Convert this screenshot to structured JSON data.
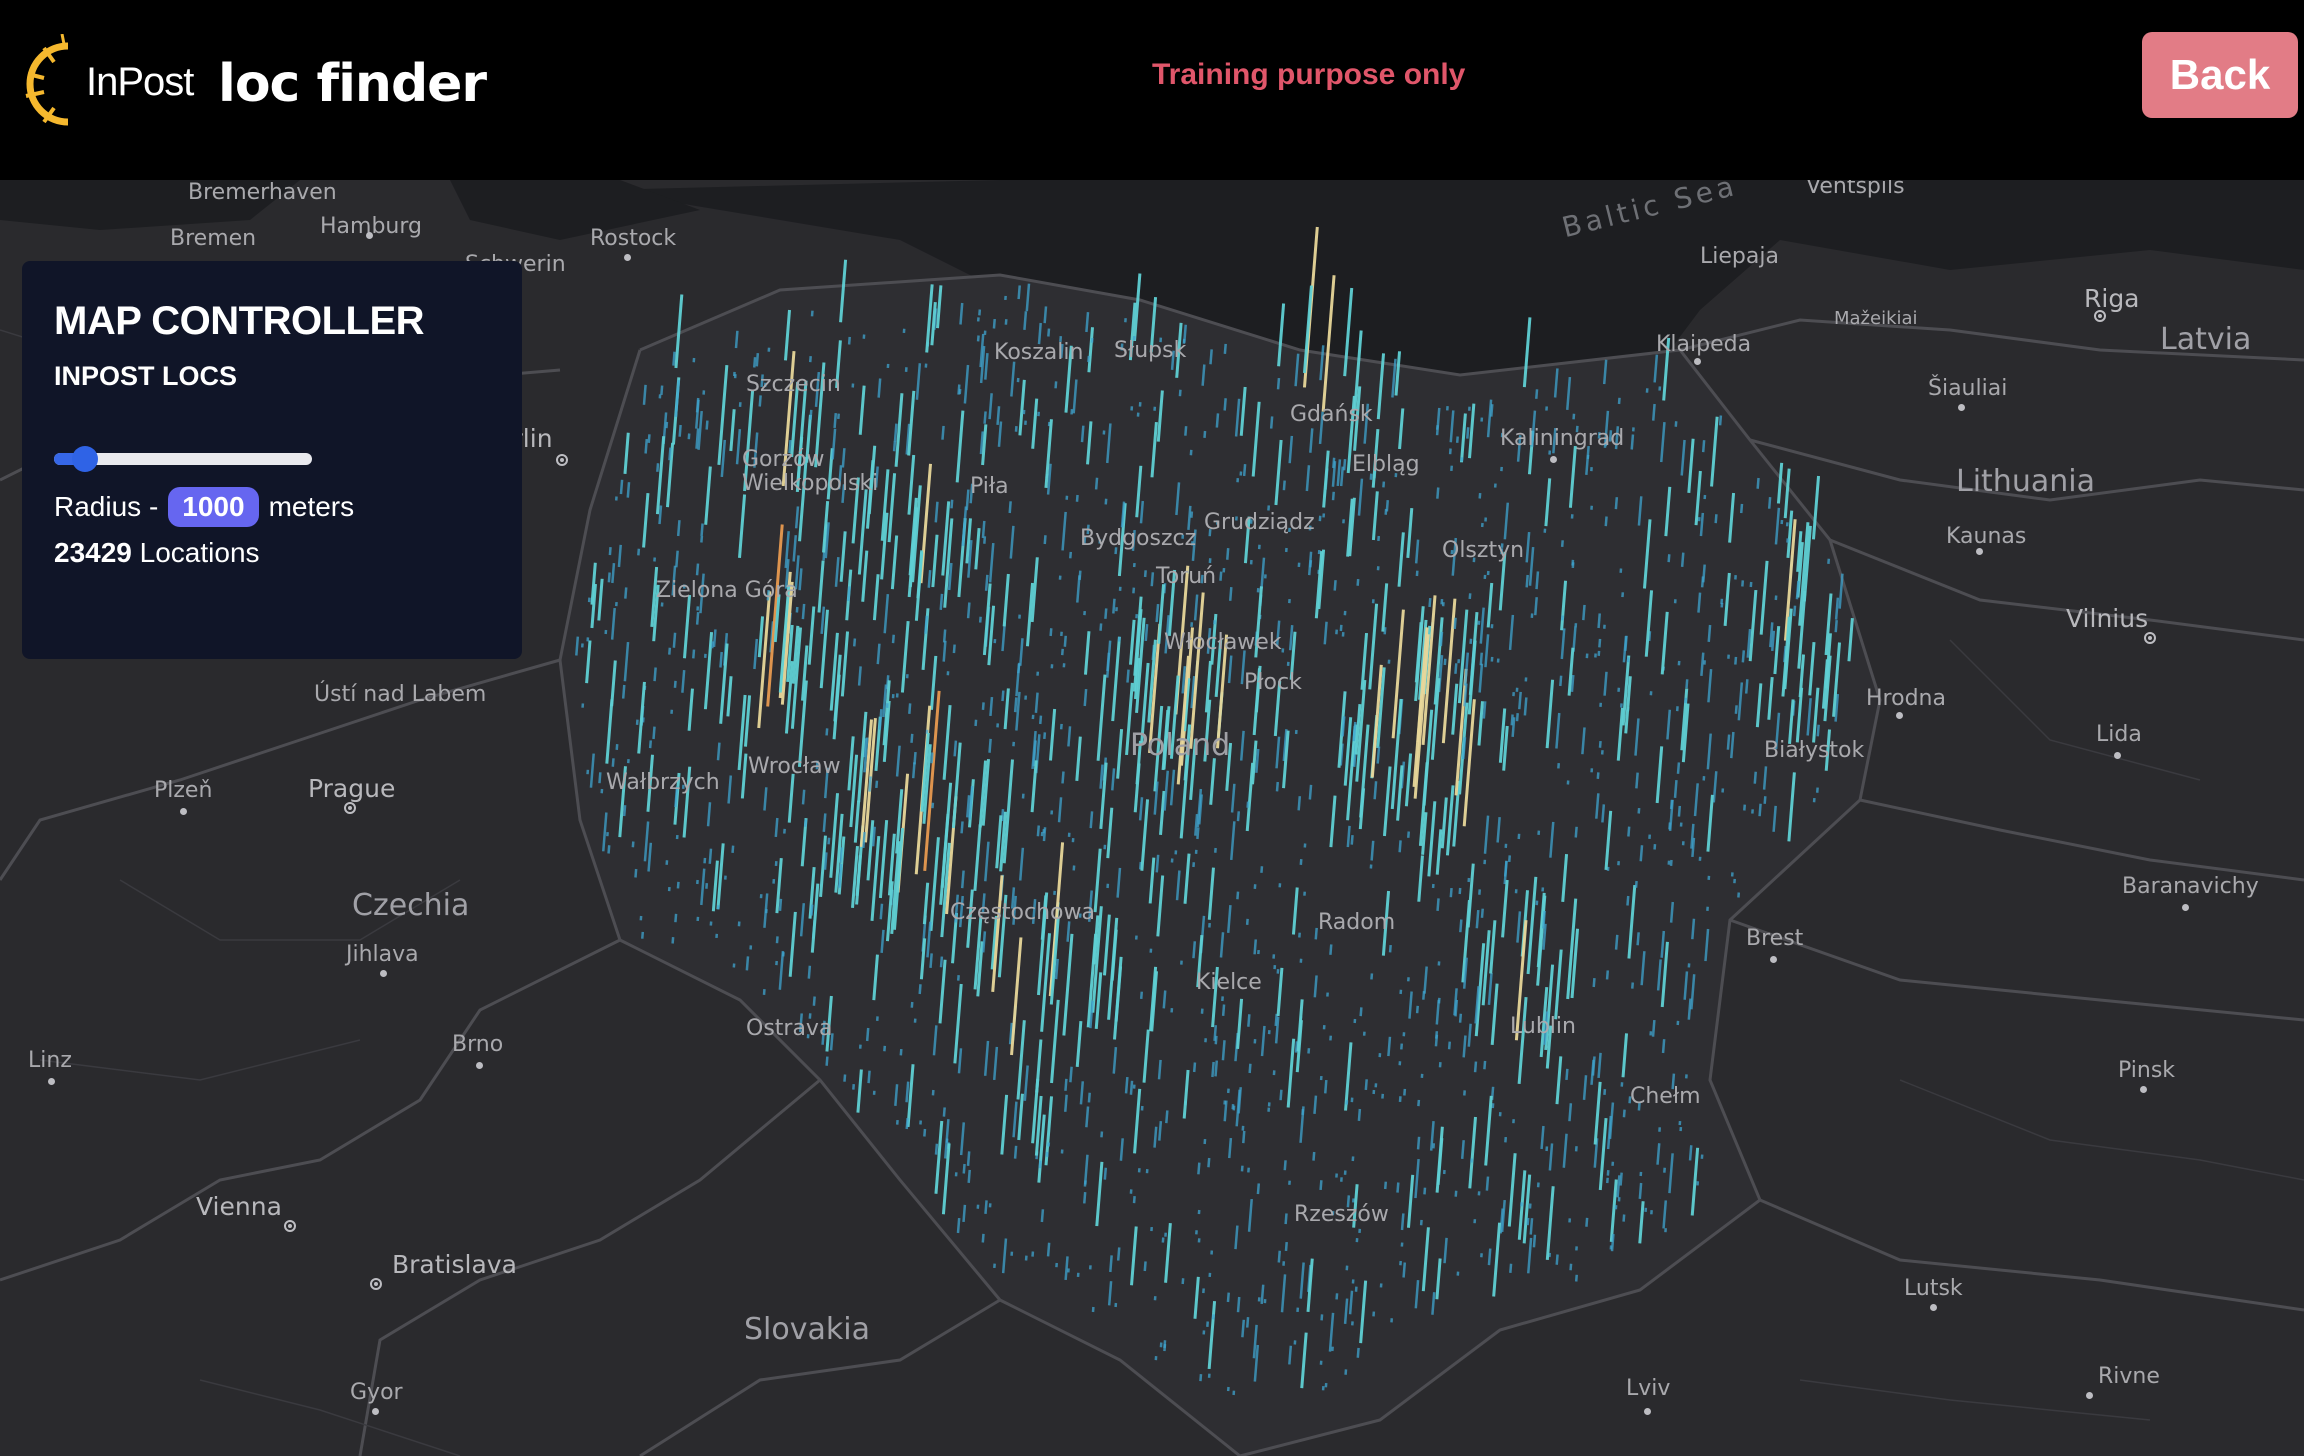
{
  "header": {
    "logo_text": "InPost",
    "app_title": "loc finder",
    "notice": "Training purpose only",
    "back_label": "Back",
    "logo_color": "#f5b82e",
    "notice_color": "#e0566a",
    "back_button_color": "#e27c86"
  },
  "controller": {
    "title": "MAP CONTROLLER",
    "subtitle": "INPOST LOCS",
    "slider_level": 0.07,
    "radius_prefix": "Radius -",
    "radius_value": "1000",
    "radius_unit": "meters",
    "locations_count": "23429",
    "locations_label": "Locations",
    "panel_color": "#101528",
    "accent_color": "#6666f0"
  },
  "map": {
    "cities": [
      {
        "name": "Bremerhaven"
      },
      {
        "name": "Hamburg"
      },
      {
        "name": "Bremen"
      },
      {
        "name": "Rostock"
      },
      {
        "name": "Schwerin"
      },
      {
        "name": "Berlin"
      },
      {
        "name": "Koszalin"
      },
      {
        "name": "Słupsk"
      },
      {
        "name": "Szczecin"
      },
      {
        "name": "Gorzów Wielkopolski"
      },
      {
        "name": "Piła"
      },
      {
        "name": "Bydgoszcz"
      },
      {
        "name": "Grudziądz"
      },
      {
        "name": "Toruń"
      },
      {
        "name": "Gdańsk"
      },
      {
        "name": "Elbląg"
      },
      {
        "name": "Olsztyn"
      },
      {
        "name": "Kaliningrad"
      },
      {
        "name": "Klaipeda"
      },
      {
        "name": "Liepaja"
      },
      {
        "name": "Ventspils"
      },
      {
        "name": "Mažeikiai"
      },
      {
        "name": "Šiauliai"
      },
      {
        "name": "Riga"
      },
      {
        "name": "Kaunas"
      },
      {
        "name": "Vilnius"
      },
      {
        "name": "Hrodna"
      },
      {
        "name": "Lida"
      },
      {
        "name": "Białystok"
      },
      {
        "name": "Baranavichy"
      },
      {
        "name": "Brest"
      },
      {
        "name": "Pinsk"
      },
      {
        "name": "Lutsk"
      },
      {
        "name": "Rivne"
      },
      {
        "name": "Lviv"
      },
      {
        "name": "Chełm"
      },
      {
        "name": "Lublin"
      },
      {
        "name": "Radom"
      },
      {
        "name": "Kielce"
      },
      {
        "name": "Rzeszów"
      },
      {
        "name": "Częstochowa"
      },
      {
        "name": "Włocławek"
      },
      {
        "name": "Płock"
      },
      {
        "name": "Zielona Góra"
      },
      {
        "name": "Wrocław"
      },
      {
        "name": "Wałbrzych"
      },
      {
        "name": "Ústí nad Labem"
      },
      {
        "name": "Prague"
      },
      {
        "name": "Plzeň"
      },
      {
        "name": "Jihlava"
      },
      {
        "name": "Brno"
      },
      {
        "name": "Ostrava"
      },
      {
        "name": "Linz"
      },
      {
        "name": "Vienna"
      },
      {
        "name": "Bratislava"
      },
      {
        "name": "Gyor"
      }
    ],
    "countries": [
      {
        "name": "Czechia"
      },
      {
        "name": "Slovakia"
      },
      {
        "name": "Lithuania"
      },
      {
        "name": "Latvia"
      },
      {
        "name": "Poland"
      }
    ],
    "sea": "Baltic Sea",
    "bar_colors": [
      "#3fa4cf",
      "#5fd0d4",
      "#e8d79a",
      "#e89a50",
      "#d8333a"
    ]
  }
}
